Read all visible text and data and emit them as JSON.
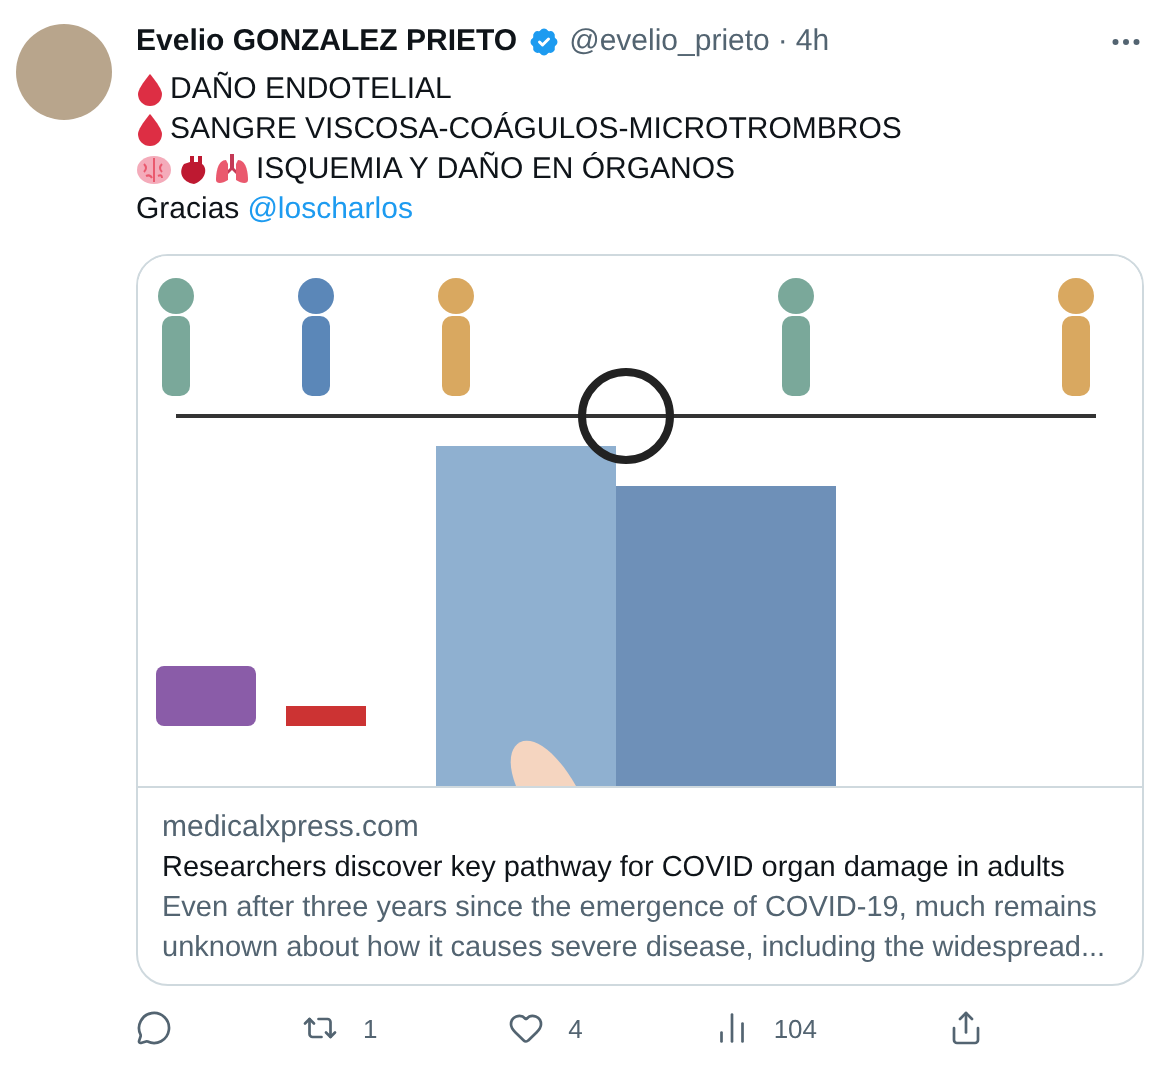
{
  "tweet": {
    "name": "Evelio GONZALEZ PRIETO",
    "verified": true,
    "handle": "@evelio_prieto",
    "separator": "·",
    "time": "4h",
    "lines": [
      {
        "icons": [
          {
            "kind": "drop"
          }
        ],
        "text": "DAÑO ENDOTELIAL"
      },
      {
        "icons": [
          {
            "kind": "drop"
          }
        ],
        "text": "SANGRE VISCOSA-COÁGULOS-MICROTROMBROS"
      },
      {
        "icons": [
          {
            "kind": "brain"
          },
          {
            "kind": "heart"
          },
          {
            "kind": "lungs"
          }
        ],
        "text": "ISQUEMIA Y DAÑO EN ÓRGANOS"
      }
    ],
    "thanks": {
      "text": "Gracias",
      "mention": "@loscharlos"
    }
  },
  "card": {
    "domain": "medicalxpress.com",
    "title": "Researchers discover key pathway for COVID organ damage in adults",
    "description": "Even after three years since the emergence of COVID-19, much remains unknown about how it causes severe disease, including the widespread..."
  },
  "actions": [
    {
      "kind": "reply"
    },
    {
      "kind": "retweet",
      "count": "1"
    },
    {
      "kind": "like",
      "count": "4"
    },
    {
      "kind": "views",
      "count": "104"
    },
    {
      "kind": "share"
    }
  ]
}
